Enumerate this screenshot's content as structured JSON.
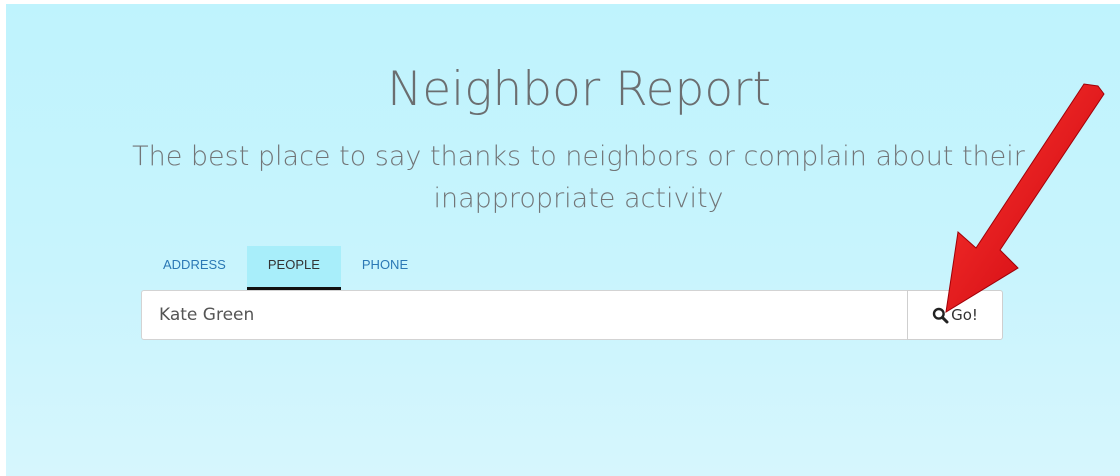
{
  "header": {
    "title": "Neighbor Report",
    "subtitle": "The best place to say thanks to neighbors or complain about their inappropriate activity"
  },
  "tabs": [
    {
      "label": "ADDRESS",
      "active": false
    },
    {
      "label": "PEOPLE",
      "active": true
    },
    {
      "label": "PHONE",
      "active": false
    }
  ],
  "search": {
    "value": "Kate Green",
    "button_label": "Go!",
    "button_icon": "search-icon"
  },
  "annotation": {
    "icon": "arrow-pointer-icon",
    "color": "#e3111b"
  },
  "colors": {
    "background": "#c4f4fd",
    "active_tab": "#a8eefa",
    "tab_link": "#2b78b5"
  }
}
